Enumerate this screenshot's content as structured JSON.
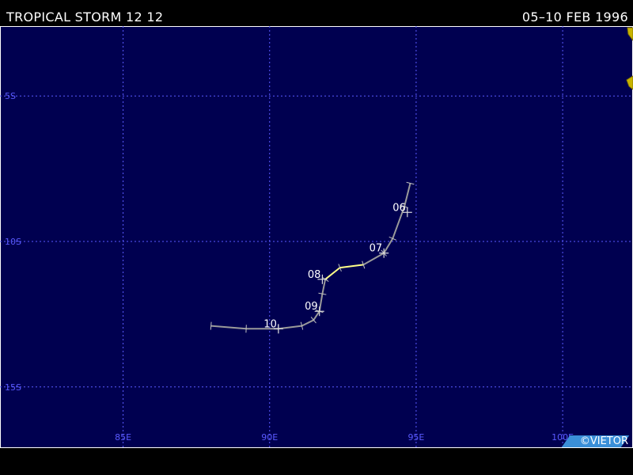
{
  "header": {
    "storm_name": "TROPICAL STORM 12 12",
    "date_range": "05–10 FEB 1996"
  },
  "map": {
    "lon_range": [
      80.8,
      102.4
    ],
    "lat_range": [
      -2.6,
      -17.1
    ],
    "longitude_labels": [
      {
        "lon": 85,
        "label": "85E"
      },
      {
        "lon": 90,
        "label": "90E"
      },
      {
        "lon": 95,
        "label": "95E"
      },
      {
        "lon": 100,
        "label": "100E"
      }
    ],
    "latitude_labels": [
      {
        "lat": -5,
        "label": "5S"
      },
      {
        "lat": -10,
        "label": "10S"
      },
      {
        "lat": -15,
        "label": "15S"
      }
    ],
    "track": [
      {
        "lon": 94.8,
        "lat": -8.0
      },
      {
        "lon": 94.6,
        "lat": -8.8
      },
      {
        "lon": 94.2,
        "lat": -9.9
      },
      {
        "lon": 93.9,
        "lat": -10.4
      },
      {
        "lon": 93.2,
        "lat": -10.8
      },
      {
        "lon": 92.4,
        "lat": -10.9
      },
      {
        "lon": 91.9,
        "lat": -11.3
      },
      {
        "lon": 91.8,
        "lat": -11.8
      },
      {
        "lon": 91.7,
        "lat": -12.4
      },
      {
        "lon": 91.5,
        "lat": -12.7
      },
      {
        "lon": 91.1,
        "lat": -12.9
      },
      {
        "lon": 90.3,
        "lat": -13.0
      },
      {
        "lon": 89.2,
        "lat": -13.0
      },
      {
        "lon": 88.0,
        "lat": -12.9
      }
    ],
    "track_segments": [
      {
        "from": 0,
        "to": 4,
        "intensity": "depression",
        "color": "#9a9a9a"
      },
      {
        "from": 4,
        "to": 6,
        "intensity": "storm",
        "color": "#ffff88"
      },
      {
        "from": 6,
        "to": 13,
        "intensity": "depression",
        "color": "#9a9a9a"
      }
    ],
    "day_labels": [
      {
        "text": "06",
        "lon": 94.7,
        "lat": -9.0
      },
      {
        "text": "07",
        "lon": 93.9,
        "lat": -10.4
      },
      {
        "text": "08",
        "lon": 91.8,
        "lat": -11.3
      },
      {
        "text": "09",
        "lon": 91.7,
        "lat": -12.4
      },
      {
        "text": "10",
        "lon": 90.3,
        "lat": -13.0
      }
    ],
    "colors": {
      "ocean": "#000050",
      "grid": "#5a5aff",
      "land": "#c8b400",
      "border": "#ffffff"
    }
  },
  "copyright": "©VIETOR"
}
